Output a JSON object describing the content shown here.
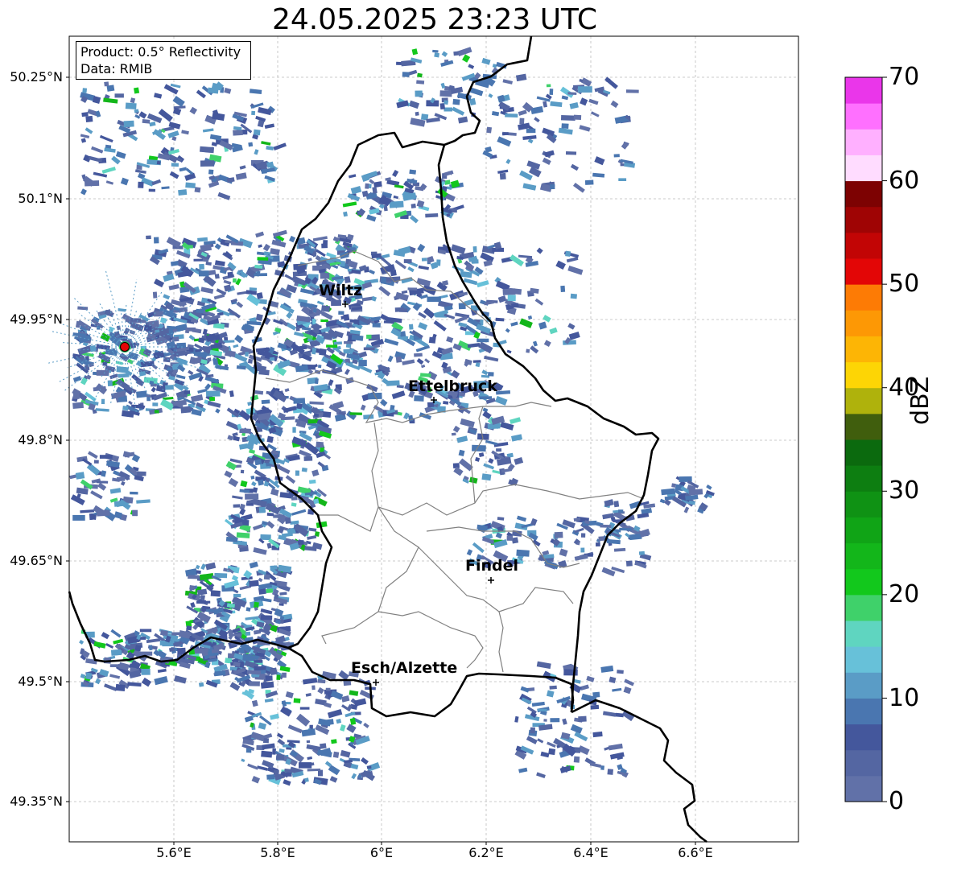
{
  "title": "24.05.2025 23:23 UTC",
  "info": {
    "product": "Product: 0.5° Reflectivity",
    "data": "Data: RMIB"
  },
  "lat_labels": [
    "50.25°N",
    "50.1°N",
    "49.95°N",
    "49.8°N",
    "49.65°N",
    "49.5°N",
    "49.35°N"
  ],
  "lon_labels": [
    "5.6°E",
    "5.8°E",
    "6°E",
    "6.2°E",
    "6.4°E",
    "6.6°E"
  ],
  "cities": {
    "wiltz": "Wiltz",
    "ettelbruck": "Ettelbruck",
    "findel": "Findel",
    "esch": "Esch/Alzette"
  },
  "colorbar": {
    "label": "dBZ",
    "ticks": [
      "0",
      "10",
      "20",
      "30",
      "40",
      "50",
      "60",
      "70"
    ],
    "colors": [
      "#6171a8",
      "#5466a2",
      "#44579c",
      "#4a76b0",
      "#5a9cc6",
      "#67c1d9",
      "#5fd5c0",
      "#3fd16a",
      "#12c81c",
      "#13b61a",
      "#10a416",
      "#0f9214",
      "#0d7e11",
      "#0b6a0e",
      "#405e0d",
      "#afb20c",
      "#fdd505",
      "#fdb505",
      "#fd9805",
      "#fd7b05",
      "#e30606",
      "#c20505",
      "#9f0404",
      "#7d0202",
      "#ffdcff",
      "#ffb0ff",
      "#ff70ff",
      "#ea36ea"
    ]
  },
  "map_data": {
    "radar_site": "red-marker",
    "accent_colors": {
      "border": "#000000",
      "cantons": "#808080",
      "grid": "#bbbbbb"
    }
  }
}
